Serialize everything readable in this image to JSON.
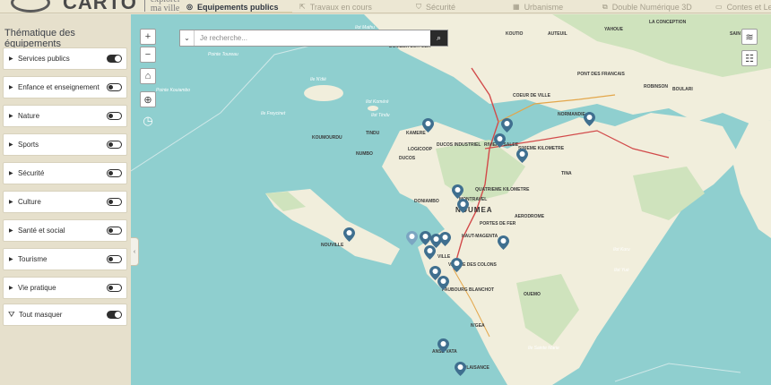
{
  "brand": {
    "name": "CARTO",
    "tagline_1": "explorer",
    "tagline_2": "ma ville"
  },
  "nav": {
    "tabs": [
      {
        "label": "Equipements publics",
        "icon": "map-pin-icon",
        "active": true
      },
      {
        "label": "Travaux en cours",
        "icon": "external-link-icon",
        "active": false
      },
      {
        "label": "Sécurité",
        "icon": "shield-icon",
        "active": false
      },
      {
        "label": "Urbanisme",
        "icon": "buildings-icon",
        "active": false
      },
      {
        "label": "Double Numérique 3D",
        "icon": "cube-icon",
        "active": false
      },
      {
        "label": "Contes et Le",
        "icon": "book-icon",
        "active": false
      }
    ]
  },
  "sidebar": {
    "title": "Thématique des équipements",
    "items": [
      {
        "label": "Services publics",
        "on": true
      },
      {
        "label": "Enfance et enseignement",
        "on": false
      },
      {
        "label": "Nature",
        "on": false
      },
      {
        "label": "Sports",
        "on": false
      },
      {
        "label": "Sécurité",
        "on": false
      },
      {
        "label": "Culture",
        "on": false
      },
      {
        "label": "Santé et social",
        "on": false
      },
      {
        "label": "Tourisme",
        "on": false
      },
      {
        "label": "Vie pratique",
        "on": false
      }
    ],
    "hide_all": {
      "label": "Tout masquer",
      "on": true
    }
  },
  "search": {
    "placeholder": "Je recherche..."
  },
  "colors": {
    "accent": "#2e2e2e",
    "water": "#8fcfcf",
    "land": "#f1eedc",
    "pin": "#3f6f8f"
  },
  "map": {
    "labels": {
      "water": [
        "Ilot Mathu",
        "Pointe Toureau",
        "Pointe Kouiambo",
        "Ile N'dié",
        "Ile Freycinet",
        "Ilot Koméré",
        "Ilot Tindu",
        "Ilot Kuru",
        "Ilot Yué",
        "Ile Sainte Marie"
      ],
      "district": [
        "DOMBEA SUR MER",
        "KOUTIO",
        "AUTEUIL",
        "YAHOUE",
        "LA CONCEPTION",
        "SAIN",
        "PONT DES FRANCAIS",
        "ROBINSON",
        "BOULARI",
        "COEUR DE VILLE",
        "NORMANDIE",
        "KOUMOURDU",
        "TINDU",
        "KAMERE",
        "DUCOS INDUSTRIEL",
        "RIVIERE SALEE",
        "LOGICOOP",
        "NUMBO",
        "DUCOS",
        "SIXIEME KILOMETRE",
        "TINA",
        "QUATRIEME KILOMETRE",
        "MONTRAVEL",
        "DONIAMBO",
        "AERODROME",
        "PORTES DE FER",
        "VALLEE DES COLONS",
        "HAUT-MAGENTA",
        "NOUVILLE",
        "VILLE",
        "FAUBOURG BLANCHOT",
        "OUEMO",
        "N'GEA",
        "ANSE VATA",
        "PLAISANCE"
      ],
      "city": "NOUMEA"
    }
  }
}
